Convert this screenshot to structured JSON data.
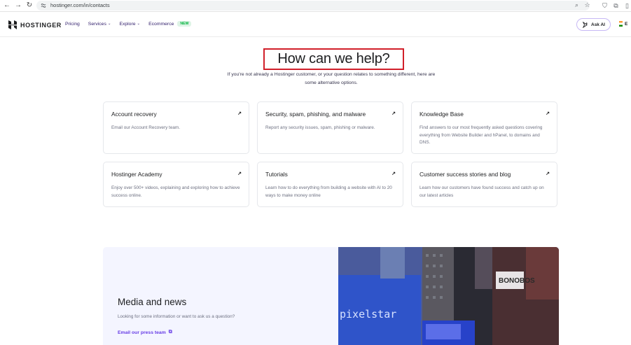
{
  "browser": {
    "url": "hostinger.com/in/contacts"
  },
  "header": {
    "brand": "HOSTINGER",
    "nav": [
      {
        "label": "Pricing",
        "dropdown": false
      },
      {
        "label": "Services",
        "dropdown": true
      },
      {
        "label": "Explore",
        "dropdown": true
      },
      {
        "label": "Ecommerce",
        "dropdown": false,
        "badge": "NEW"
      }
    ],
    "ask_ai": "Ask AI",
    "lang": "E"
  },
  "hero": {
    "title": "How can we help?",
    "subtitle_line1": "If you're not already a Hostinger customer, or your question relates to something different, here are",
    "subtitle_line2": "some alternative options."
  },
  "cards": [
    {
      "title": "Account recovery",
      "desc": "Email our Account Recovery team."
    },
    {
      "title": "Security, spam, phishing, and malware",
      "desc": "Report any security issues, spam, phishing or malware."
    },
    {
      "title": "Knowledge Base",
      "desc": "Find answers to our most frequently asked questions covering everything from Website Builder and hPanel, to domains and DNS."
    },
    {
      "title": "Hostinger Academy",
      "desc": "Enjoy over 500+ videos, explaining and exploring how to achieve success online."
    },
    {
      "title": "Tutorials",
      "desc": "Learn how to do everything from building a website with AI to 20 ways to make money online"
    },
    {
      "title": "Customer success stories and blog",
      "desc": "Learn how our customers have found success and catch up on our latest articles"
    }
  ],
  "media": {
    "title": "Media and news",
    "subtitle": "Looking for some information or want to ask us a question?",
    "link": "Email our press team",
    "photo_text_1": "pixelstar",
    "photo_text_2": "BONOBOS"
  },
  "colors": {
    "accent": "#673de6",
    "highlight": "#d11f2a",
    "new_badge_bg": "#def4e6",
    "new_badge_text": "#00b33c"
  }
}
